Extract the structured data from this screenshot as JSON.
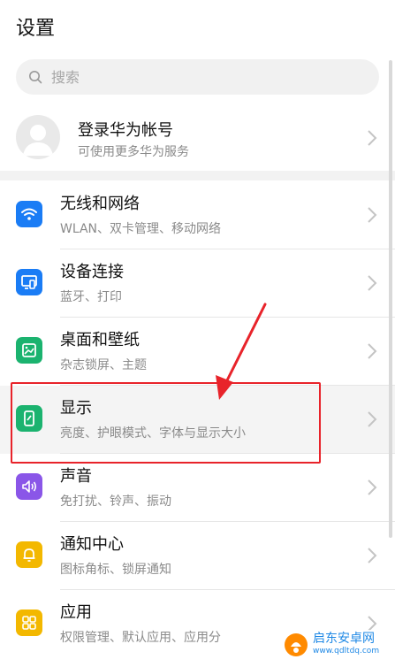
{
  "page": {
    "title": "设置"
  },
  "search": {
    "placeholder": "搜索"
  },
  "account": {
    "name": "登录华为帐号",
    "subtitle": "可使用更多华为服务"
  },
  "items": [
    {
      "label": "无线和网络",
      "desc": "WLAN、双卡管理、移动网络",
      "icon": "wifi-icon",
      "color": "#1a7cf5"
    },
    {
      "label": "设备连接",
      "desc": "蓝牙、打印",
      "icon": "device-connection-icon",
      "color": "#1a7cf5"
    },
    {
      "label": "桌面和壁纸",
      "desc": "杂志锁屏、主题",
      "icon": "wallpaper-icon",
      "color": "#1bb36f"
    },
    {
      "label": "显示",
      "desc": "亮度、护眼模式、字体与显示大小",
      "icon": "display-icon",
      "color": "#1bb36f"
    },
    {
      "label": "声音",
      "desc": "免打扰、铃声、振动",
      "icon": "sound-icon",
      "color": "#8a56e8"
    },
    {
      "label": "通知中心",
      "desc": "图标角标、锁屏通知",
      "icon": "notification-icon",
      "color": "#f3b800"
    },
    {
      "label": "应用",
      "desc": "权限管理、默认应用、应用分",
      "icon": "apps-icon",
      "color": "#f3b800"
    }
  ],
  "annotation": {
    "highlight_color": "#e8232a"
  },
  "watermark": {
    "name": "启东安卓网",
    "url": "www.qdltdq.com"
  }
}
